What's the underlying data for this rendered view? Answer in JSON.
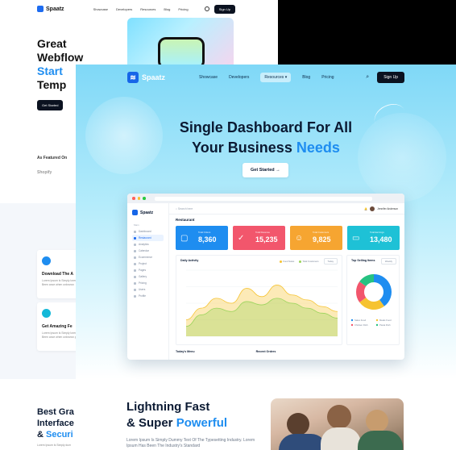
{
  "back_template": {
    "brand": "Spaatz",
    "nav_links": [
      "Showcase",
      "Developers",
      "Resources",
      "Blog",
      "Pricing"
    ],
    "signup": "Sign Up",
    "hero_line1": "Great",
    "hero_line2": "Webflow",
    "hero_line3": "Start",
    "hero_line4": "Temp",
    "get_started": "Get Started",
    "featured": "As Featured On",
    "featured_logo": "Shopify",
    "feature1_title": "Download The A",
    "feature1_desc": "Lorem Ipsum Is Simply lorem Ipsum Has Been ance when unknown",
    "feature2_title": "Get Amazing Fe",
    "feature2_desc": "Lorem Ipsum Is Simply lorem Ipsum Has Been ance when unknown pri"
  },
  "main_template": {
    "brand": "Spaatz",
    "nav_links": [
      "Showcase",
      "Developers",
      "Resources",
      "Blog",
      "Pricing"
    ],
    "signup": "Sign Up",
    "headline_line1": "Single Dashboard For All",
    "headline_line2a": "Your Business ",
    "headline_line2b": "Needs",
    "cta": "Get Started",
    "dashboard": {
      "brand": "Spaatz",
      "search_placeholder": "Search here",
      "user_name": "Jennifer Anderson",
      "section_title": "Restaurant",
      "sidebar_section": "Main",
      "sidebar_items": [
        "Dashboard",
        "Restaurant",
        "Analytics",
        "Calendar",
        "Ecommerce",
        "Project",
        "Pages",
        "Gallery",
        "Pricing",
        "Users",
        "Profile"
      ],
      "cards": [
        {
          "label": "Total Orders",
          "value": "8,360",
          "color": "#1e8df0",
          "icon": "box-icon"
        },
        {
          "label": "Total Revenue",
          "value": "15,235",
          "color": "#f2566c",
          "icon": "check-circle-icon"
        },
        {
          "label": "Total Customers",
          "value": "9,825",
          "color": "#f6a531",
          "icon": "user-icon"
        },
        {
          "label": "Total Earnings",
          "value": "13,480",
          "color": "#1ec1d6",
          "icon": "credit-card-icon"
        }
      ],
      "sales_panel": {
        "title": "Daily Activity",
        "legend": [
          "Food Sales",
          "Total Customers"
        ],
        "select": "Today"
      },
      "top_panel": {
        "title": "Top Selling Items",
        "select": "Weekly",
        "legend": [
          "Sales Food",
          "Meals Food",
          "Chicken Dish",
          "Pasta Dish"
        ]
      },
      "bottom_left": "Today's Menu",
      "bottom_right": "Recent Orders"
    }
  },
  "lower": {
    "left_head1": "Best Gra",
    "left_head2": "Interface",
    "left_head3": "& ",
    "left_head3_accent": "Securi",
    "left_sub": "Lorem Ipsum Is Simply dum",
    "mid_head1": "Lightning Fast",
    "mid_head2a": "& Super ",
    "mid_head2b": "Powerful",
    "mid_desc": "Lorem Ipsum Is Simply Dummy Text Of The Typesetting Industry. Lorem Ipsum Has Been The Industry's Standard"
  },
  "chart_data": [
    {
      "type": "area",
      "title": "Daily Activity",
      "series": [
        {
          "name": "Food Sales",
          "values": [
            20,
            34,
            46,
            40,
            58,
            48,
            62,
            50,
            44,
            36,
            30
          ]
        },
        {
          "name": "Total Customers",
          "values": [
            12,
            26,
            34,
            30,
            42,
            38,
            46,
            40,
            34,
            28,
            22
          ]
        }
      ],
      "ylim": [
        0,
        80
      ]
    },
    {
      "type": "pie",
      "title": "Top Selling Items",
      "categories": [
        "Sales Food",
        "Meals Food",
        "Chicken Dish",
        "Pasta Dish"
      ],
      "values": [
        40,
        25,
        20,
        15
      ],
      "colors": [
        "#1e8df0",
        "#f6c331",
        "#f2566c",
        "#26c281"
      ]
    }
  ]
}
